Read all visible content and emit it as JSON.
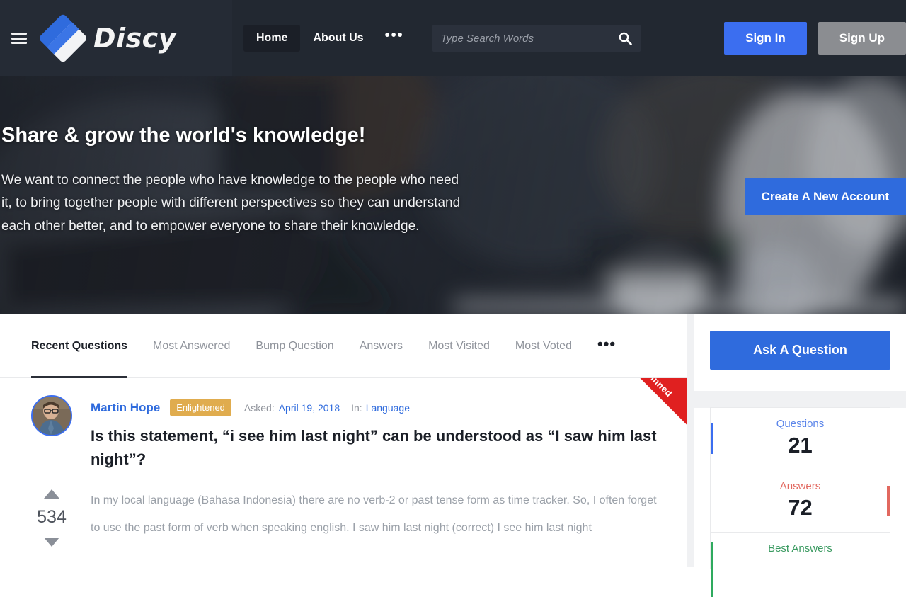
{
  "header": {
    "logo_text": "Discy",
    "menu_icon": "hamburger-icon",
    "nav": [
      {
        "label": "Home",
        "active": true
      },
      {
        "label": "About Us",
        "active": false
      }
    ],
    "nav_more": "•••",
    "search": {
      "placeholder": "Type Search Words",
      "value": "",
      "icon": "search-icon"
    },
    "sign_in": "Sign In",
    "sign_up": "Sign Up",
    "colors": {
      "bar": "#222831",
      "left_panel": "#252b35",
      "primary": "#3b6ef0",
      "secondary": "#8b8d91"
    }
  },
  "hero": {
    "title": "Share & grow the world's knowledge!",
    "subtitle": "We want to connect the people who have knowledge to the people who need it, to bring together people with different perspectives so they can understand each other better, and to empower everyone to share their knowledge.",
    "cta": "Create A New Account",
    "cta_color": "#2f6bdd"
  },
  "main": {
    "tabs": [
      {
        "label": "Recent Questions",
        "active": true
      },
      {
        "label": "Most Answered",
        "active": false
      },
      {
        "label": "Bump Question",
        "active": false
      },
      {
        "label": "Answers",
        "active": false
      },
      {
        "label": "Most Visited",
        "active": false
      },
      {
        "label": "Most Voted",
        "active": false
      }
    ],
    "tabs_more": "•••",
    "question": {
      "ribbon": "Pinned",
      "ribbon_color": "#e02020",
      "author": "Martin Hope",
      "badge": "Enlightened",
      "badge_color": "#e0ac4e",
      "asked_label": "Asked:",
      "asked_date": "April 19, 2018",
      "in_label": "In:",
      "category": "Language",
      "title": "Is this statement, “i see him last night” can be understood as “I saw him last night”?",
      "excerpt": "In my local language (Bahasa Indonesia) there are no verb-2 or past tense form as time tracker. So, I often forget to use the past form of verb when speaking english. I saw him last night (correct) I see him last night",
      "vote_count": "534",
      "vote_up_icon": "triangle-up-icon",
      "vote_down_icon": "triangle-down-icon"
    }
  },
  "sidebar": {
    "ask_button": "Ask A Question",
    "ask_color": "#2f6bdd",
    "stats": [
      {
        "label": "Questions",
        "value": "21",
        "color": "#3b6ef0",
        "bar_side": "left"
      },
      {
        "label": "Answers",
        "value": "72",
        "color": "#e2685f",
        "bar_side": "right"
      },
      {
        "label": "Best Answers",
        "value": "",
        "color": "#2eaa5e",
        "bar_side": "left"
      }
    ]
  }
}
